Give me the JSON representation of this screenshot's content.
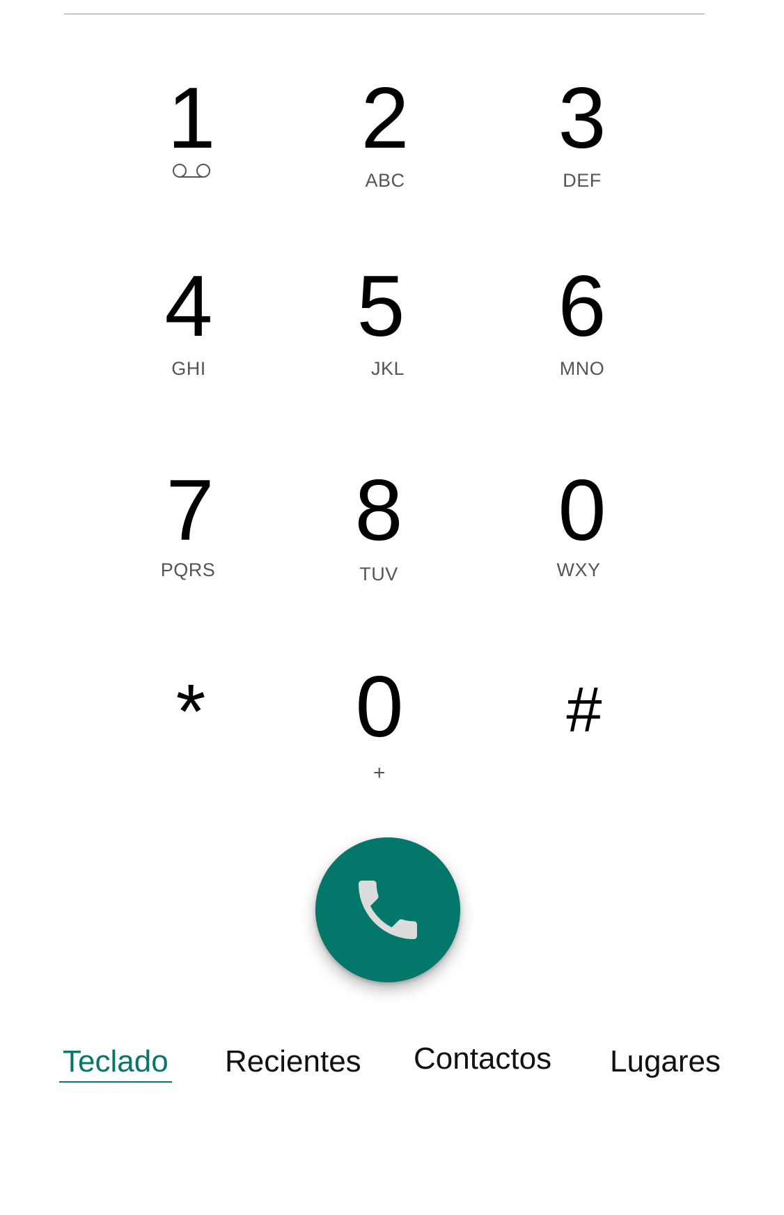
{
  "dialpad": {
    "keys": [
      {
        "digit": "1",
        "letters": "",
        "icon": "voicemail-icon"
      },
      {
        "digit": "2",
        "letters": "ABC"
      },
      {
        "digit": "3",
        "letters": "DEF"
      },
      {
        "digit": "4",
        "letters": "GHI"
      },
      {
        "digit": "5",
        "letters": "JKL"
      },
      {
        "digit": "6",
        "letters": "MNO"
      },
      {
        "digit": "7",
        "letters": "PQRS"
      },
      {
        "digit": "8",
        "letters": "TUV"
      },
      {
        "digit": "0",
        "letters": "WXY"
      },
      {
        "digit": "*",
        "letters": ""
      },
      {
        "digit": "0",
        "letters": "+"
      },
      {
        "digit": "#",
        "letters": ""
      }
    ]
  },
  "call_button": {
    "icon": "phone-icon",
    "color": "#03786a"
  },
  "tabs": [
    {
      "label": "Teclado",
      "active": true
    },
    {
      "label": "Recientes",
      "active": false
    },
    {
      "label": "Contactos",
      "active": false
    },
    {
      "label": "Lugares",
      "active": false
    }
  ],
  "colors": {
    "accent": "#03786a",
    "text": "#000000",
    "subtext": "#555555"
  }
}
